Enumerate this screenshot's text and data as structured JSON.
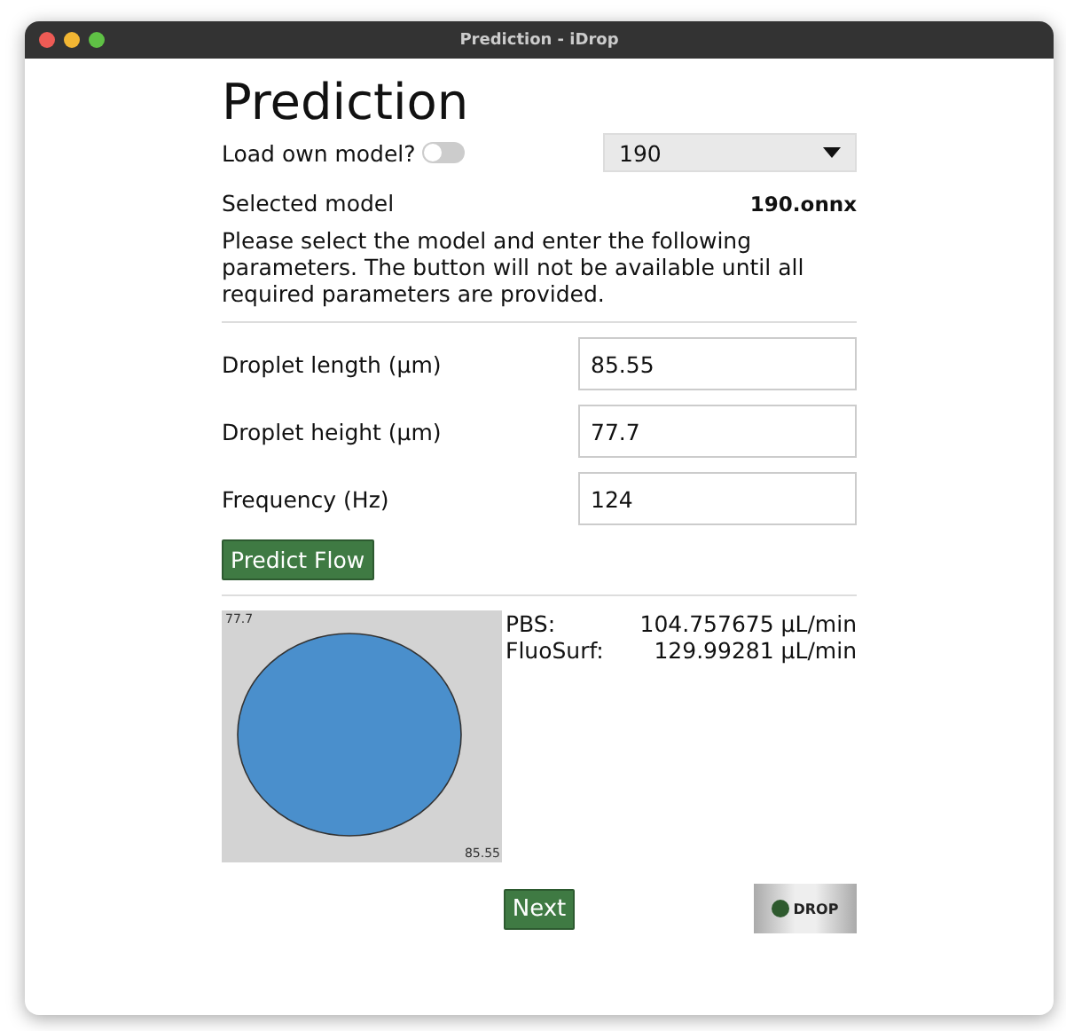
{
  "window": {
    "title": "Prediction - iDrop"
  },
  "heading": "Prediction",
  "own_model": {
    "label": "Load own model?",
    "on": false
  },
  "model_select": {
    "value": "190"
  },
  "selected_model": {
    "label": "Selected model",
    "value": "190.onnx"
  },
  "instructions": "Please select the model and enter the following parameters. The button will not be available until all required parameters are provided.",
  "parameters": [
    {
      "label": "Droplet length (µm)",
      "value": "85.55"
    },
    {
      "label": "Droplet height (µm)",
      "value": "77.7"
    },
    {
      "label": "Frequency (Hz)",
      "value": "124"
    }
  ],
  "predict_button": "Predict Flow",
  "droplet_preview": {
    "height_label": "77.7",
    "length_label": "85.55"
  },
  "results": [
    {
      "name": "PBS:",
      "value": "104.757675 µL/min"
    },
    {
      "name": "FluoSurf:",
      "value": "129.99281 µL/min"
    }
  ],
  "next_button": "Next",
  "logo": {
    "text": "DROP"
  }
}
